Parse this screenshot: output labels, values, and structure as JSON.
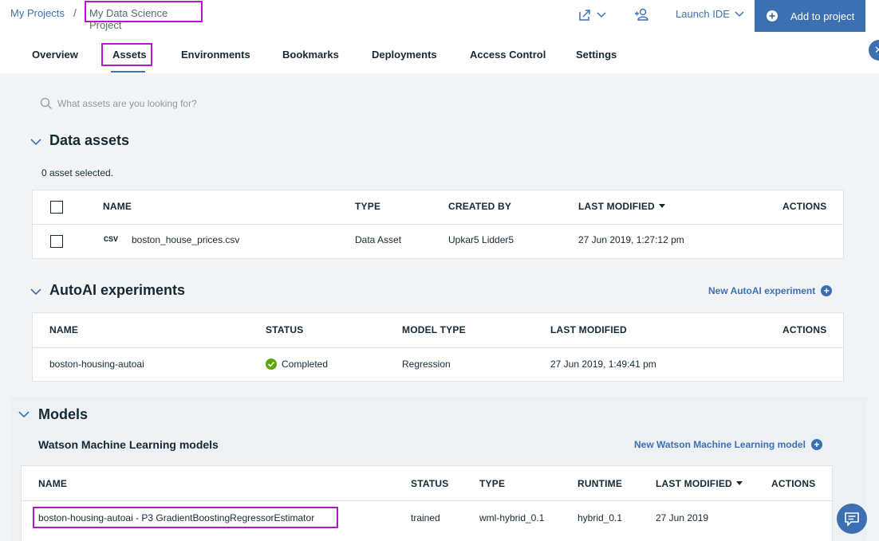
{
  "header": {
    "breadcrumb_root": "My Projects",
    "breadcrumb_sep": "/",
    "breadcrumb_current": "My Data Science Project",
    "launch_ide": "Launch IDE",
    "add_to_project": "Add to project"
  },
  "tabs": [
    "Overview",
    "Assets",
    "Environments",
    "Bookmarks",
    "Deployments",
    "Access Control",
    "Settings"
  ],
  "search": {
    "placeholder": "What assets are you looking for?"
  },
  "data_assets": {
    "title": "Data assets",
    "selected_text": "0 asset selected.",
    "columns": [
      "NAME",
      "TYPE",
      "CREATED BY",
      "LAST MODIFIED",
      "ACTIONS"
    ],
    "rows": [
      {
        "icon_text": "CSV",
        "name": "boston_house_prices.csv",
        "type": "Data Asset",
        "created_by": "Upkar5 Lidder5",
        "last_modified": "27 Jun 2019, 1:27:12 pm"
      }
    ]
  },
  "autoai": {
    "title": "AutoAI experiments",
    "new_link": "New AutoAI experiment",
    "columns": [
      "NAME",
      "STATUS",
      "MODEL TYPE",
      "LAST MODIFIED",
      "ACTIONS"
    ],
    "rows": [
      {
        "name": "boston-housing-autoai",
        "status": "Completed",
        "model_type": "Regression",
        "last_modified": "27 Jun 2019, 1:49:41 pm"
      }
    ]
  },
  "models": {
    "title": "Models",
    "subtitle": "Watson Machine Learning models",
    "new_link": "New Watson Machine Learning model",
    "columns": [
      "NAME",
      "STATUS",
      "TYPE",
      "RUNTIME",
      "LAST MODIFIED",
      "ACTIONS"
    ],
    "rows": [
      {
        "name": "boston-housing-autoai - P3 GradientBoostingRegressorEstimator",
        "status": "trained",
        "type": "wml-hybrid_0.1",
        "runtime": "hybrid_0.1",
        "last_modified": "27 Jun 2019"
      }
    ]
  },
  "colors": {
    "accent": "#3d70b2",
    "highlight": "#b217c9",
    "success": "#5aa700"
  }
}
